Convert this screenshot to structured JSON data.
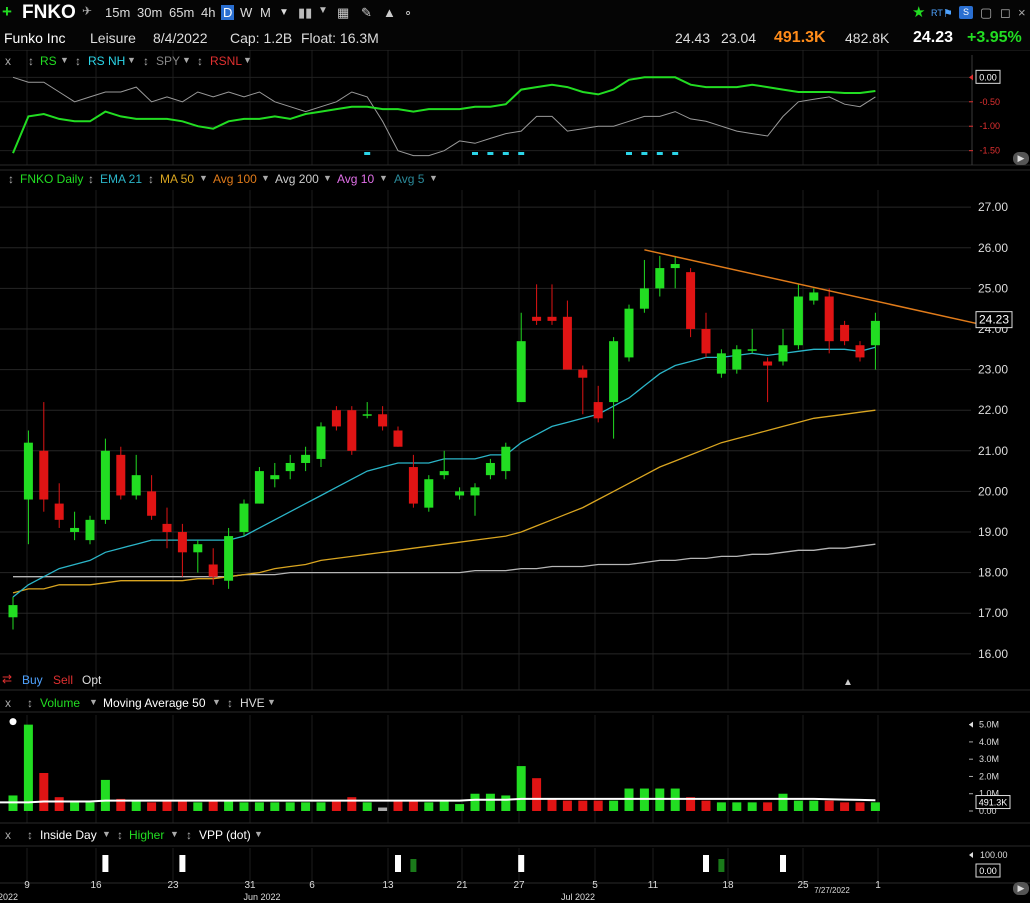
{
  "toolbar": {
    "symbol": "FNKO",
    "timeframes": [
      "15m",
      "30m",
      "65m",
      "4h",
      "D",
      "W",
      "M"
    ],
    "active_timeframe": "D",
    "right_badges": [
      "RT"
    ]
  },
  "info": {
    "name": "Funko Inc",
    "sector": "Leisure",
    "date": "8/4/2022",
    "cap": "Cap: 1.2B",
    "float": "Float: 16.3M",
    "high": "24.43",
    "low": "23.04",
    "volume": "491.3K",
    "avg_volume": "482.8K",
    "last": "24.23",
    "change": "+3.95%"
  },
  "rs_panel": {
    "close_label": "x",
    "items": [
      "RS",
      "RS NH",
      "SPY",
      "RSNL"
    ],
    "axis": [
      "0.00",
      "-0.50",
      "-1.00",
      "-1.50"
    ]
  },
  "price_panel": {
    "legend": [
      "FNKO Daily",
      "EMA 21",
      "MA 50",
      "Avg 100",
      "Avg 200",
      "Avg 10",
      "Avg 5"
    ],
    "axis": [
      "27.00",
      "26.00",
      "25.00",
      "24.00",
      "23.00",
      "22.00",
      "21.00",
      "20.00",
      "19.00",
      "18.00",
      "17.00",
      "16.00"
    ],
    "last_price_tag": "24.23",
    "buttons": [
      "Buy",
      "Sell",
      "Opt"
    ]
  },
  "volume_panel": {
    "close_label": "x",
    "legend": [
      "Volume",
      "Moving Average 50",
      "HVE"
    ],
    "axis": [
      "5.0M",
      "4.0M",
      "3.0M",
      "2.0M",
      "1.0M",
      "0.00"
    ],
    "last_volume_tag": "491.3K"
  },
  "bottom_panel": {
    "close_label": "x",
    "legend": [
      "Inside Day",
      "Higher",
      "VPP (dot)"
    ],
    "axis": [
      "100.00",
      "0.00"
    ]
  },
  "x_axis": {
    "ticks": [
      "9",
      "16",
      "23",
      "31",
      "6",
      "13",
      "21",
      "27",
      "5",
      "11",
      "18",
      "25",
      "1"
    ],
    "months": [
      "2022",
      "Jun 2022",
      "Jul 2022"
    ],
    "cursor_date": "7/27/2022"
  },
  "colors": {
    "up": "#22dd22",
    "down": "#e01414",
    "ema21": "#2bb5c8",
    "ma50": "#d9a520",
    "avg200": "#bbbbbb",
    "trendline": "#e07b1a",
    "rs_line": "#22dd22",
    "change": "#22dd22",
    "volume_highlight": "#ff8c1a"
  },
  "chart_data": {
    "type": "candlestick",
    "ylim": [
      15.7,
      27.3
    ],
    "candles": [
      {
        "o": 16.9,
        "h": 17.4,
        "l": 16.6,
        "c": 17.2
      },
      {
        "o": 19.8,
        "h": 21.5,
        "l": 18.7,
        "c": 21.2
      },
      {
        "o": 21.0,
        "h": 22.2,
        "l": 19.5,
        "c": 19.8
      },
      {
        "o": 19.7,
        "h": 20.2,
        "l": 19.1,
        "c": 19.3
      },
      {
        "o": 19.0,
        "h": 19.5,
        "l": 18.8,
        "c": 19.1
      },
      {
        "o": 18.8,
        "h": 19.4,
        "l": 18.7,
        "c": 19.3
      },
      {
        "o": 19.3,
        "h": 21.3,
        "l": 19.2,
        "c": 21.0
      },
      {
        "o": 20.9,
        "h": 21.1,
        "l": 19.8,
        "c": 19.9
      },
      {
        "o": 19.9,
        "h": 20.9,
        "l": 19.8,
        "c": 20.4
      },
      {
        "o": 20.0,
        "h": 20.4,
        "l": 19.3,
        "c": 19.4
      },
      {
        "o": 19.2,
        "h": 19.6,
        "l": 18.6,
        "c": 19.0
      },
      {
        "o": 19.0,
        "h": 19.2,
        "l": 17.9,
        "c": 18.5
      },
      {
        "o": 18.5,
        "h": 18.8,
        "l": 18.0,
        "c": 18.7
      },
      {
        "o": 18.2,
        "h": 18.6,
        "l": 17.7,
        "c": 17.9
      },
      {
        "o": 17.8,
        "h": 19.1,
        "l": 17.6,
        "c": 18.9
      },
      {
        "o": 19.0,
        "h": 19.8,
        "l": 18.9,
        "c": 19.7
      },
      {
        "o": 19.7,
        "h": 20.6,
        "l": 19.7,
        "c": 20.5
      },
      {
        "o": 20.3,
        "h": 20.7,
        "l": 20.1,
        "c": 20.4
      },
      {
        "o": 20.5,
        "h": 20.9,
        "l": 20.3,
        "c": 20.7
      },
      {
        "o": 20.7,
        "h": 21.1,
        "l": 20.5,
        "c": 20.9
      },
      {
        "o": 20.8,
        "h": 21.7,
        "l": 20.6,
        "c": 21.6
      },
      {
        "o": 22.0,
        "h": 22.1,
        "l": 21.5,
        "c": 21.6
      },
      {
        "o": 22.0,
        "h": 22.1,
        "l": 20.9,
        "c": 21.0
      },
      {
        "o": 21.9,
        "h": 22.2,
        "l": 21.8,
        "c": 21.9
      },
      {
        "o": 21.9,
        "h": 22.1,
        "l": 21.5,
        "c": 21.6
      },
      {
        "o": 21.5,
        "h": 21.6,
        "l": 21.1,
        "c": 21.1
      },
      {
        "o": 20.6,
        "h": 20.9,
        "l": 19.6,
        "c": 19.7
      },
      {
        "o": 19.6,
        "h": 20.4,
        "l": 19.5,
        "c": 20.3
      },
      {
        "o": 20.4,
        "h": 21.0,
        "l": 20.3,
        "c": 20.5
      },
      {
        "o": 19.9,
        "h": 20.1,
        "l": 19.8,
        "c": 20.0
      },
      {
        "o": 19.9,
        "h": 20.2,
        "l": 19.4,
        "c": 20.1
      },
      {
        "o": 20.4,
        "h": 20.8,
        "l": 20.3,
        "c": 20.7
      },
      {
        "o": 20.5,
        "h": 21.2,
        "l": 20.3,
        "c": 21.1
      },
      {
        "o": 22.2,
        "h": 24.4,
        "l": 22.2,
        "c": 23.7
      },
      {
        "o": 24.3,
        "h": 25.1,
        "l": 24.1,
        "c": 24.2
      },
      {
        "o": 24.3,
        "h": 25.1,
        "l": 24.1,
        "c": 24.2
      },
      {
        "o": 24.3,
        "h": 24.7,
        "l": 23.0,
        "c": 23.0
      },
      {
        "o": 23.0,
        "h": 23.1,
        "l": 21.9,
        "c": 22.8
      },
      {
        "o": 22.2,
        "h": 22.6,
        "l": 21.7,
        "c": 21.8
      },
      {
        "o": 22.2,
        "h": 23.8,
        "l": 21.3,
        "c": 23.7
      },
      {
        "o": 23.3,
        "h": 24.6,
        "l": 23.2,
        "c": 24.5
      },
      {
        "o": 24.5,
        "h": 25.7,
        "l": 24.4,
        "c": 25.0
      },
      {
        "o": 25.0,
        "h": 25.8,
        "l": 24.8,
        "c": 25.5
      },
      {
        "o": 25.5,
        "h": 25.8,
        "l": 25.0,
        "c": 25.6
      },
      {
        "o": 25.4,
        "h": 25.5,
        "l": 23.8,
        "c": 24.0
      },
      {
        "o": 24.0,
        "h": 24.4,
        "l": 23.3,
        "c": 23.4
      },
      {
        "o": 22.9,
        "h": 23.5,
        "l": 22.8,
        "c": 23.4
      },
      {
        "o": 23.0,
        "h": 23.6,
        "l": 22.9,
        "c": 23.5
      },
      {
        "o": 23.5,
        "h": 24.0,
        "l": 23.4,
        "c": 23.5
      },
      {
        "o": 23.2,
        "h": 23.3,
        "l": 22.2,
        "c": 23.1
      },
      {
        "o": 23.2,
        "h": 24.0,
        "l": 23.1,
        "c": 23.6
      },
      {
        "o": 23.6,
        "h": 25.1,
        "l": 23.5,
        "c": 24.8
      },
      {
        "o": 24.7,
        "h": 25.0,
        "l": 24.6,
        "c": 24.9
      },
      {
        "o": 24.8,
        "h": 25.0,
        "l": 23.4,
        "c": 23.7
      },
      {
        "o": 24.1,
        "h": 24.2,
        "l": 23.6,
        "c": 23.7
      },
      {
        "o": 23.6,
        "h": 23.7,
        "l": 23.2,
        "c": 23.3
      },
      {
        "o": 23.6,
        "h": 24.4,
        "l": 23.0,
        "c": 24.2
      }
    ],
    "ema21": [
      17.4,
      17.7,
      17.9,
      18.1,
      18.2,
      18.3,
      18.5,
      18.6,
      18.7,
      18.8,
      18.8,
      18.8,
      18.8,
      18.8,
      18.8,
      18.9,
      19.1,
      19.3,
      19.5,
      19.7,
      19.9,
      20.1,
      20.3,
      20.5,
      20.6,
      20.7,
      20.7,
      20.7,
      20.8,
      20.8,
      20.8,
      20.9,
      20.9,
      21.2,
      21.4,
      21.6,
      21.7,
      21.8,
      21.9,
      22.1,
      22.3,
      22.6,
      22.9,
      23.1,
      23.2,
      23.3,
      23.3,
      23.35,
      23.4,
      23.35,
      23.4,
      23.45,
      23.5,
      23.5,
      23.5,
      23.45,
      23.55
    ],
    "ma50": [
      17.5,
      17.6,
      17.6,
      17.7,
      17.7,
      17.7,
      17.75,
      17.8,
      17.8,
      17.8,
      17.8,
      17.8,
      17.85,
      17.85,
      17.9,
      17.95,
      18.0,
      18.1,
      18.15,
      18.2,
      18.3,
      18.35,
      18.4,
      18.45,
      18.5,
      18.55,
      18.6,
      18.65,
      18.7,
      18.75,
      18.8,
      18.85,
      18.9,
      19.0,
      19.15,
      19.3,
      19.45,
      19.6,
      19.8,
      20.0,
      20.2,
      20.4,
      20.6,
      20.75,
      20.9,
      21.05,
      21.2,
      21.3,
      21.4,
      21.5,
      21.6,
      21.7,
      21.8,
      21.85,
      21.9,
      21.95,
      22.0
    ],
    "avg200": [
      17.9,
      17.9,
      17.9,
      17.9,
      17.9,
      17.9,
      17.9,
      17.9,
      17.9,
      17.9,
      17.9,
      17.9,
      17.9,
      17.9,
      17.9,
      17.95,
      17.95,
      17.95,
      18.0,
      18.0,
      18.0,
      18.0,
      18.0,
      18.0,
      18.0,
      18.0,
      18.0,
      18.0,
      18.0,
      18.0,
      18.05,
      18.05,
      18.05,
      18.1,
      18.1,
      18.15,
      18.15,
      18.15,
      18.2,
      18.2,
      18.2,
      18.25,
      18.3,
      18.3,
      18.35,
      18.35,
      18.4,
      18.4,
      18.45,
      18.45,
      18.5,
      18.55,
      18.55,
      18.6,
      18.6,
      18.65,
      18.7
    ],
    "trendline": {
      "from_index": 41,
      "from_value": 25.95,
      "to_index": 63,
      "to_value": 24.1
    },
    "volume": [
      0.9,
      5.0,
      2.2,
      0.8,
      0.6,
      0.5,
      1.8,
      0.7,
      0.6,
      0.5,
      0.6,
      0.6,
      0.5,
      0.6,
      0.6,
      0.5,
      0.5,
      0.5,
      0.5,
      0.5,
      0.5,
      0.6,
      0.8,
      0.5,
      0.2,
      0.6,
      0.6,
      0.5,
      0.6,
      0.4,
      1.0,
      1.0,
      0.9,
      2.6,
      1.9,
      0.7,
      0.6,
      0.6,
      0.6,
      0.6,
      1.3,
      1.3,
      1.3,
      1.3,
      0.8,
      0.6,
      0.5,
      0.5,
      0.5,
      0.5,
      1.0,
      0.6,
      0.6,
      0.6,
      0.5,
      0.5,
      0.5
    ],
    "volume_ma50": [
      0.5,
      0.5,
      0.55,
      0.55,
      0.55,
      0.55,
      0.6,
      0.6,
      0.6,
      0.6,
      0.6,
      0.6,
      0.6,
      0.6,
      0.6,
      0.6,
      0.6,
      0.6,
      0.6,
      0.6,
      0.6,
      0.6,
      0.6,
      0.6,
      0.6,
      0.6,
      0.6,
      0.6,
      0.6,
      0.6,
      0.65,
      0.65,
      0.65,
      0.7,
      0.7,
      0.7,
      0.7,
      0.7,
      0.7,
      0.7,
      0.7,
      0.7,
      0.7,
      0.7,
      0.7,
      0.7,
      0.7,
      0.7,
      0.7,
      0.7,
      0.7,
      0.7,
      0.7,
      0.68,
      0.66,
      0.64,
      0.62
    ],
    "volume_ylim": [
      0,
      5.5
    ],
    "rs": [
      -1.55,
      -0.8,
      -0.75,
      -0.85,
      -0.9,
      -0.9,
      -0.7,
      -0.8,
      -0.85,
      -0.85,
      -0.85,
      -0.9,
      -1.0,
      -1.05,
      -0.9,
      -0.85,
      -0.85,
      -0.8,
      -0.85,
      -0.75,
      -0.7,
      -0.65,
      -0.6,
      -0.6,
      -0.65,
      -0.65,
      -0.7,
      -0.65,
      -0.65,
      -0.65,
      -0.6,
      -0.6,
      -0.55,
      -0.25,
      -0.2,
      -0.15,
      -0.2,
      -0.3,
      -0.35,
      -0.25,
      -0.05,
      0.0,
      0.0,
      0.0,
      -0.15,
      -0.2,
      -0.2,
      -0.2,
      -0.15,
      -0.2,
      -0.25,
      -0.3,
      -0.3,
      -0.3,
      -0.32,
      -0.32,
      -0.28
    ],
    "spy_rel": [
      0.0,
      -0.1,
      -0.1,
      -0.3,
      -0.5,
      -0.4,
      -0.3,
      -0.3,
      -0.2,
      -0.5,
      -0.4,
      -0.5,
      -0.3,
      -0.4,
      -0.3,
      -0.4,
      -0.3,
      -0.5,
      -0.6,
      -0.7,
      -0.6,
      -0.5,
      -0.3,
      -0.4,
      -0.9,
      -1.5,
      -1.6,
      -1.6,
      -1.5,
      -1.3,
      -1.35,
      -1.25,
      -1.15,
      -1.1,
      -0.8,
      -0.8,
      -1.1,
      -1.05,
      -1.0,
      -1.0,
      -0.9,
      -0.8,
      -0.8,
      -0.7,
      -0.85,
      -0.9,
      -1.0,
      -1.1,
      -1.15,
      -1.2,
      -0.8,
      -0.5,
      -0.45,
      -0.4,
      -0.55,
      -0.6,
      -0.4
    ],
    "rs_ylim": [
      -1.65,
      0.15
    ],
    "rs_nh_markers": [
      23,
      30,
      31,
      32,
      33,
      40,
      41,
      42,
      43
    ]
  }
}
